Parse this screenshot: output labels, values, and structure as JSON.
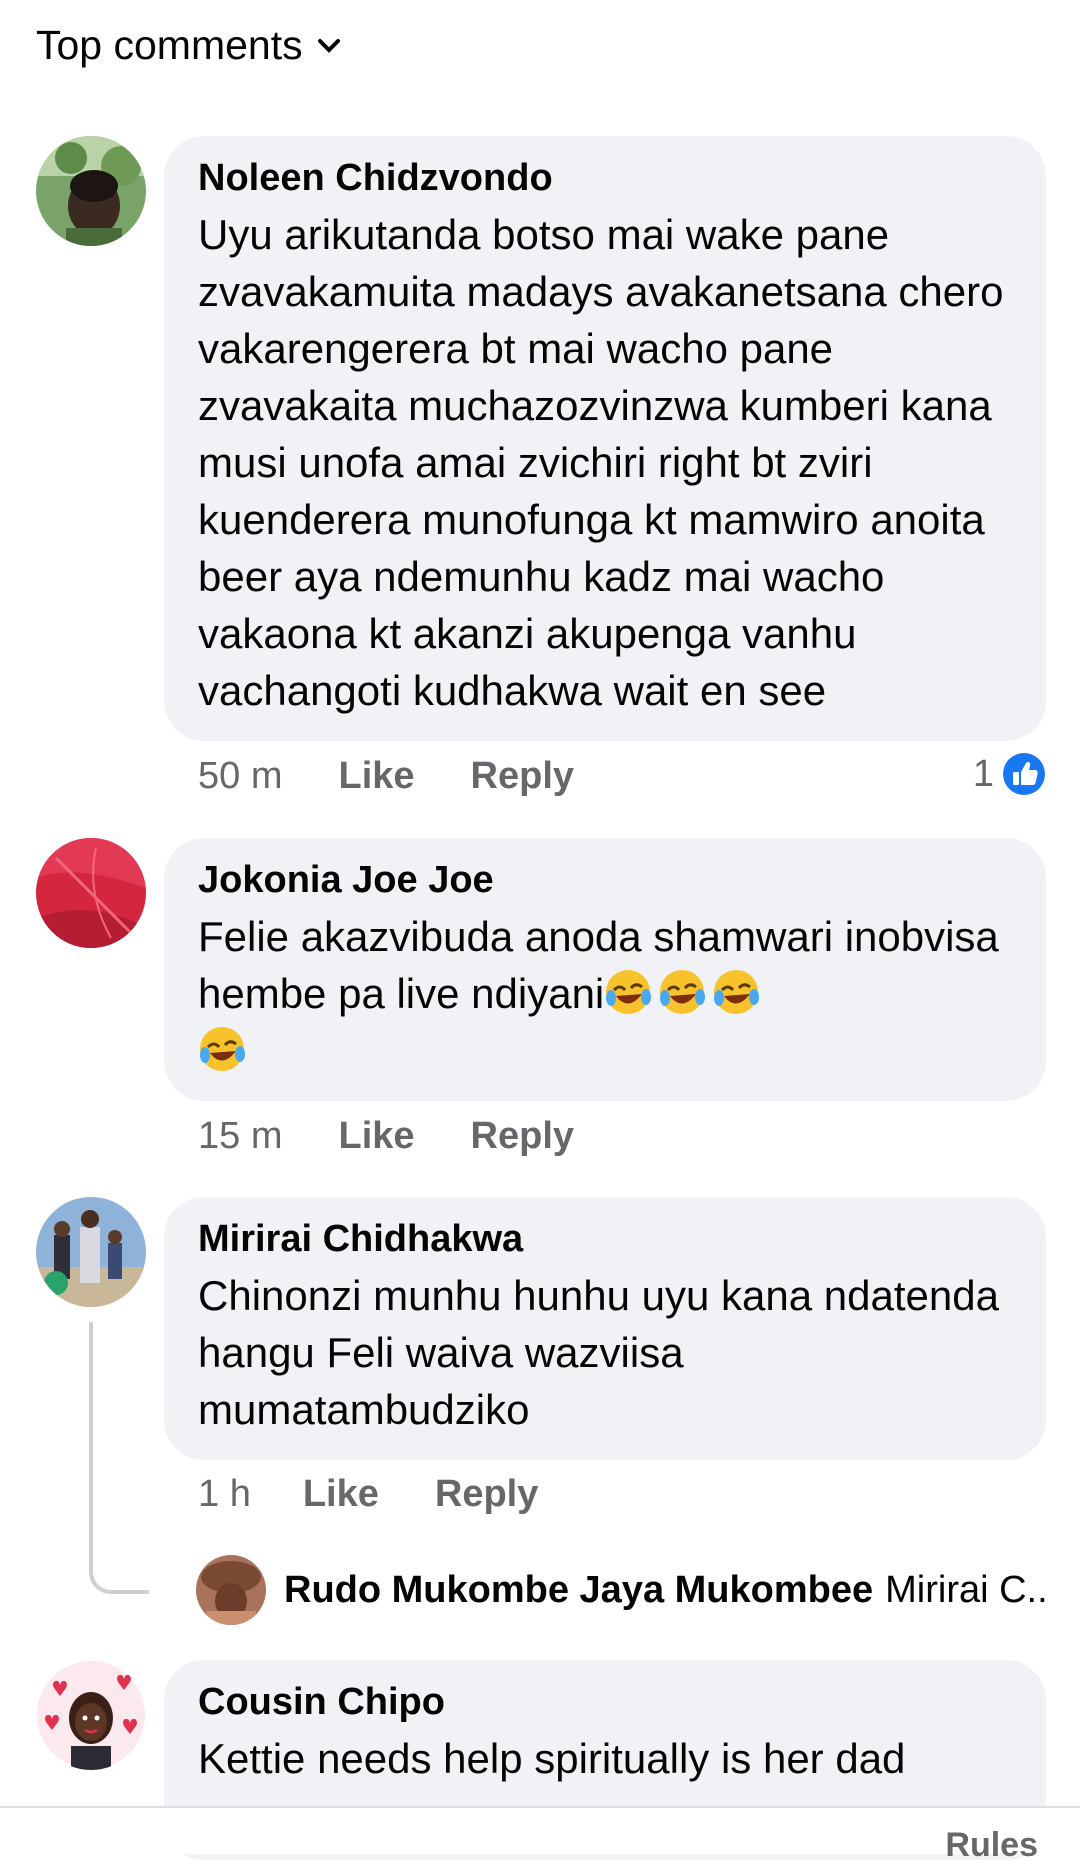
{
  "header": {
    "title": "Top comments"
  },
  "comments": [
    {
      "author": "Noleen Chidzvondo",
      "text": "Uyu arikutanda botso  mai wake pane zvavakamuita madays avakanetsana chero vakarengerera bt mai wacho pane zvavakaita muchazozvinzwa kumberi kana musi unofa amai zvichiri right bt zviri kuenderera munofunga kt mamwiro anoita beer aya ndemunhu kadz mai wacho vakaona kt akanzi akupenga vanhu vachangoti kudhakwa wait en see",
      "time": "50 m",
      "like": "Like",
      "reply": "Reply",
      "reactions": "1",
      "reaction_icon": "like-thumb-icon",
      "accent": "#1877f2"
    },
    {
      "author": "Jokonia Joe Joe",
      "text": "Felie akazvibuda anoda shamwari inobvisa hembe pa live ndiyani",
      "time": "15 m",
      "like": "Like",
      "reply": "Reply",
      "emojis": [
        "laughing-crying-emoji",
        "laughing-crying-emoji",
        "laughing-crying-emoji",
        "laughing-crying-emoji"
      ]
    },
    {
      "author": "Mirirai Chidhakwa",
      "text": "Chinonzi munhu hunhu uyu kana ndatenda hangu Feli waiva wazviisa mumatambudziko",
      "time": "1 h",
      "like": "Like",
      "reply": "Reply"
    },
    {
      "author": "Cousin Chipo",
      "text": "Kettie needs help spiritually is her dad"
    }
  ],
  "reply_preview": {
    "author": "Rudo Mukombe Jaya Mukombee",
    "snippet": "Mirirai C..."
  },
  "footer": {
    "rules": "Rules"
  }
}
